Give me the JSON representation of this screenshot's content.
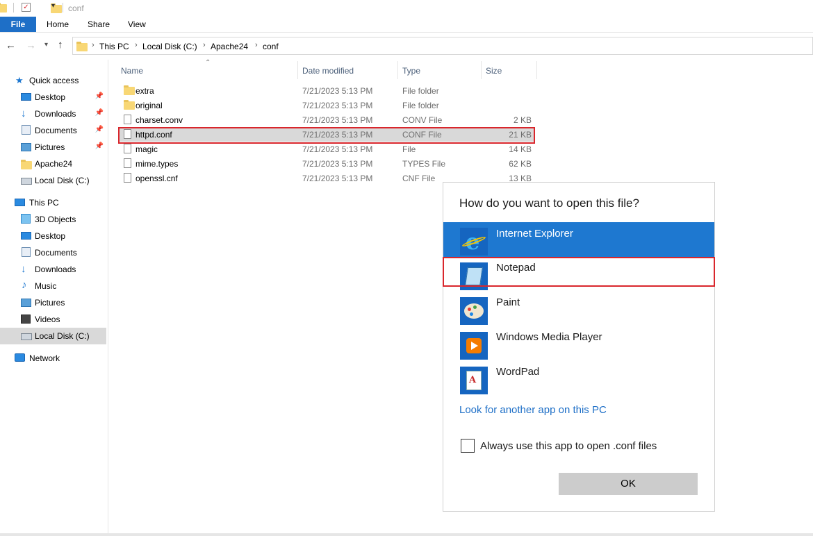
{
  "window": {
    "title": "conf"
  },
  "ribbon": {
    "tabs": [
      "File",
      "Home",
      "Share",
      "View"
    ]
  },
  "address": {
    "crumbs": [
      "This PC",
      "Local Disk (C:)",
      "Apache24",
      "conf"
    ]
  },
  "nav": {
    "quick_access": "Quick access",
    "quick_items": [
      "Desktop",
      "Downloads",
      "Documents",
      "Pictures",
      "Apache24",
      "Local Disk (C:)"
    ],
    "this_pc": "This PC",
    "pc_items": [
      "3D Objects",
      "Desktop",
      "Documents",
      "Downloads",
      "Music",
      "Pictures",
      "Videos",
      "Local Disk (C:)"
    ],
    "network": "Network"
  },
  "columns": {
    "name": "Name",
    "date": "Date modified",
    "type": "Type",
    "size": "Size"
  },
  "files": [
    {
      "name": "extra",
      "date": "7/21/2023 5:13 PM",
      "type": "File folder",
      "size": ""
    },
    {
      "name": "original",
      "date": "7/21/2023 5:13 PM",
      "type": "File folder",
      "size": ""
    },
    {
      "name": "charset.conv",
      "date": "7/21/2023 5:13 PM",
      "type": "CONV File",
      "size": "2 KB"
    },
    {
      "name": "httpd.conf",
      "date": "7/21/2023 5:13 PM",
      "type": "CONF File",
      "size": "21 KB"
    },
    {
      "name": "magic",
      "date": "7/21/2023 5:13 PM",
      "type": "File",
      "size": "14 KB"
    },
    {
      "name": "mime.types",
      "date": "7/21/2023 5:13 PM",
      "type": "TYPES File",
      "size": "62 KB"
    },
    {
      "name": "openssl.cnf",
      "date": "7/21/2023 5:13 PM",
      "type": "CNF File",
      "size": "13 KB"
    }
  ],
  "dialog": {
    "title": "How do you want to open this file?",
    "apps": [
      "Internet Explorer",
      "Notepad",
      "Paint",
      "Windows Media Player",
      "WordPad"
    ],
    "look_link": "Look for another app on this PC",
    "always_label": "Always use this app to open .conf files",
    "ok_label": "OK"
  },
  "colors": {
    "accent": "#1e6fc7",
    "highlight_box": "#d9262c",
    "selected_app": "#1e78d0"
  }
}
